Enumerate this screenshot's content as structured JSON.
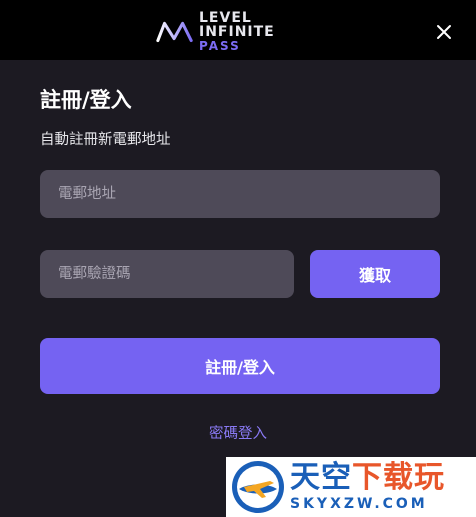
{
  "header": {
    "logo_line1": "LEVEL INFINITE",
    "logo_line2": "PASS",
    "logo_icon": "level-infinite-mark-icon",
    "close_icon": "close-icon"
  },
  "form": {
    "title": "註冊/登入",
    "subtitle": "自動註冊新電郵地址",
    "email_placeholder": "電郵地址",
    "code_placeholder": "電郵驗證碼",
    "get_code_label": "獲取",
    "submit_label": "註冊/登入",
    "password_login_label": "密碼登入"
  },
  "watermark": {
    "title_part1": "天空",
    "title_part2": "下载玩",
    "url": "SKYXZW.COM"
  },
  "colors": {
    "accent": "#7563f2",
    "link": "#8a7af5",
    "background": "#1c1a22",
    "header": "#000000",
    "input": "#4e4a58"
  }
}
